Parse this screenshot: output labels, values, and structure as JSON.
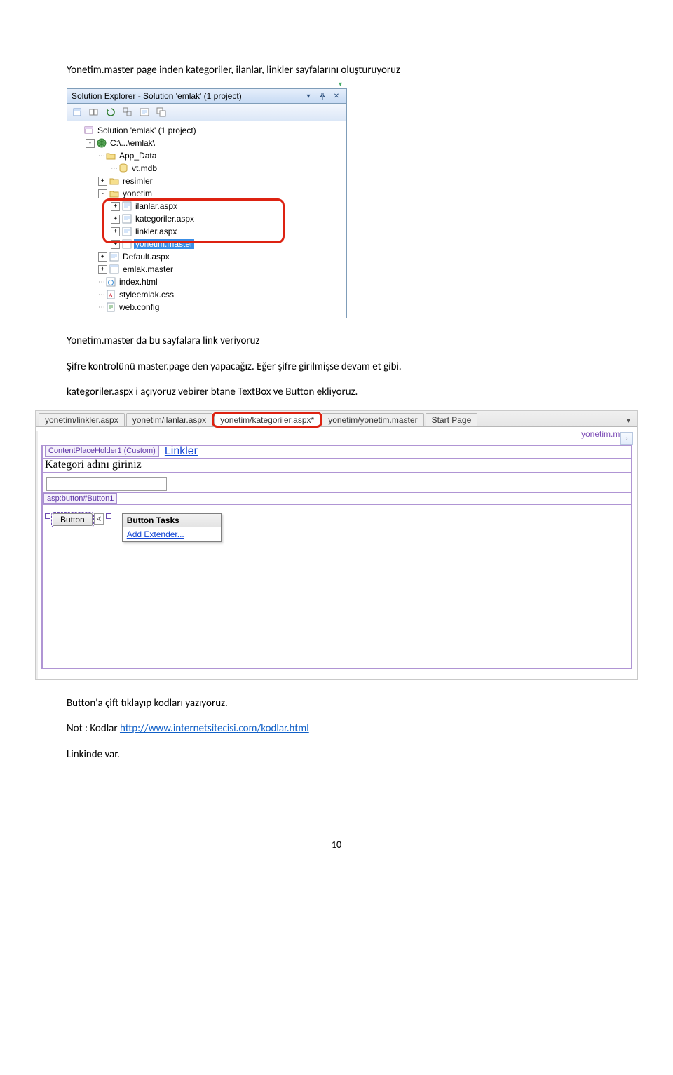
{
  "para1": "Yonetim.master page inden kategoriler, ilanlar, linkler sayfalarını oluşturuyoruz",
  "para2": "Yonetim.master   da bu sayfalara link veriyoruz",
  "para3": "Şifre kontrolünü master.page den yapacağız. Eğer şifre girilmişse devam et gibi.",
  "para4": "kategoriler.aspx i açıyoruz vebirer btane TextBox ve Button  ekliyoruz.",
  "para5": "Button'a çift tıklayıp kodları yazıyoruz.",
  "para6_prefix": "Not : Kodlar ",
  "para6_link": "http://www.internetsitecisi.com/kodlar.html",
  "para7": "Linkinde var.",
  "page_number": "10",
  "solexp": {
    "title": "Solution Explorer - Solution 'emlak' (1 project)",
    "tree": [
      {
        "depth": 0,
        "toggle": "",
        "icon": "solution",
        "label": "Solution 'emlak' (1 project)"
      },
      {
        "depth": 1,
        "toggle": "-",
        "icon": "globe",
        "label": "C:\\...\\emlak\\"
      },
      {
        "depth": 2,
        "toggle": "",
        "icon": "folder",
        "label": "App_Data",
        "dots": true
      },
      {
        "depth": 3,
        "toggle": "",
        "icon": "db",
        "label": "vt.mdb",
        "dots": true
      },
      {
        "depth": 2,
        "toggle": "+",
        "icon": "folder",
        "label": "resimler"
      },
      {
        "depth": 2,
        "toggle": "-",
        "icon": "folder",
        "label": "yonetim"
      },
      {
        "depth": 3,
        "toggle": "+",
        "icon": "aspx",
        "label": "ilanlar.aspx",
        "hl": true
      },
      {
        "depth": 3,
        "toggle": "+",
        "icon": "aspx",
        "label": "kategoriler.aspx",
        "hl": true
      },
      {
        "depth": 3,
        "toggle": "+",
        "icon": "aspx",
        "label": "linkler.aspx",
        "hl": true
      },
      {
        "depth": 3,
        "toggle": "+",
        "icon": "master",
        "label": "yonetim.master",
        "selected": true
      },
      {
        "depth": 2,
        "toggle": "+",
        "icon": "aspx",
        "label": "Default.aspx"
      },
      {
        "depth": 2,
        "toggle": "+",
        "icon": "master",
        "label": "emlak.master"
      },
      {
        "depth": 2,
        "toggle": "",
        "icon": "html",
        "label": "index.html",
        "dots": true
      },
      {
        "depth": 2,
        "toggle": "",
        "icon": "css",
        "label": "styleemlak.css",
        "dots": true
      },
      {
        "depth": 2,
        "toggle": "",
        "icon": "config",
        "label": "web.config",
        "dots": true
      }
    ]
  },
  "designer": {
    "tabs": [
      {
        "label": "yonetim/linkler.aspx"
      },
      {
        "label": "yonetim/ilanlar.aspx"
      },
      {
        "label": "yonetim/kategoriler.aspx*",
        "active": true
      },
      {
        "label": "yonetim/yonetim.master"
      },
      {
        "label": "Start Page"
      }
    ],
    "breadcrumb": "yonetim.mas",
    "links_label": "Linkler",
    "cph_tag": "ContentPlaceHolder1 (Custom)",
    "field_label": "Kategori adını giriniz",
    "button_id_tag": "asp:button#Button1",
    "button_text": "Button",
    "smarttag": {
      "title": "Button Tasks",
      "item": "Add Extender..."
    }
  }
}
